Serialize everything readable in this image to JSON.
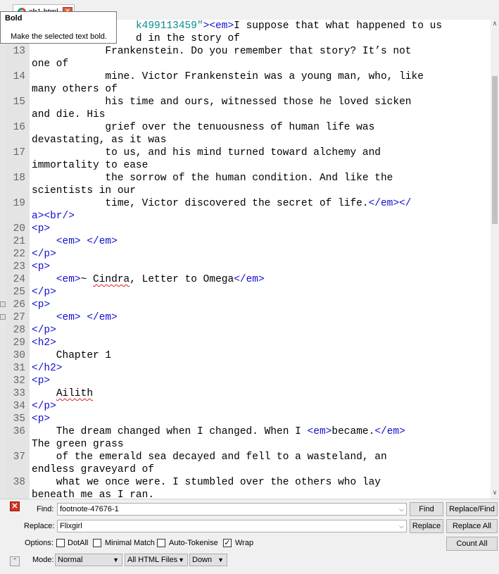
{
  "tab": {
    "label": "ch1.html",
    "close": "✕"
  },
  "tooltip": {
    "title": "Bold",
    "body": "Make the selected text bold."
  },
  "editor": {
    "lines": [
      {
        "n": "",
        "parts": [
          {
            "t": "                 "
          },
          {
            "t": "k499113459\"",
            "c": "str"
          },
          {
            "t": "><em>",
            "c": "tag"
          },
          {
            "t": "I suppose that what happened to us"
          }
        ]
      },
      {
        "n": "",
        "parts": [
          {
            "t": "                 d in the story of"
          }
        ]
      },
      {
        "n": "13",
        "parts": [
          {
            "t": "            Frankenstein. Do you remember that story? It’s not"
          }
        ]
      },
      {
        "n": "",
        "parts": [
          {
            "t": "one of"
          }
        ]
      },
      {
        "n": "14",
        "parts": [
          {
            "t": "            mine. Victor Frankenstein was a young man, who, like"
          }
        ]
      },
      {
        "n": "",
        "parts": [
          {
            "t": "many others of"
          }
        ]
      },
      {
        "n": "15",
        "parts": [
          {
            "t": "            his time and ours, witnessed those he loved sicken"
          }
        ]
      },
      {
        "n": "",
        "parts": [
          {
            "t": "and die. His"
          }
        ]
      },
      {
        "n": "16",
        "parts": [
          {
            "t": "            grief over the tenuousness of human life was"
          }
        ]
      },
      {
        "n": "",
        "parts": [
          {
            "t": "devastating, as it was"
          }
        ]
      },
      {
        "n": "17",
        "parts": [
          {
            "t": "            to us, and his mind turned toward alchemy and"
          }
        ]
      },
      {
        "n": "",
        "parts": [
          {
            "t": "immortality to ease"
          }
        ]
      },
      {
        "n": "18",
        "parts": [
          {
            "t": "            the sorrow of the human condition. And like the"
          }
        ]
      },
      {
        "n": "",
        "parts": [
          {
            "t": "scientists in our"
          }
        ]
      },
      {
        "n": "19",
        "parts": [
          {
            "t": "            time, Victor discovered the secret of life."
          },
          {
            "t": "</em></",
            "c": "tag"
          }
        ]
      },
      {
        "n": "",
        "parts": [
          {
            "t": "a><br/>",
            "c": "tag"
          }
        ]
      },
      {
        "n": "20",
        "parts": [
          {
            "t": "<p>",
            "c": "tag"
          }
        ]
      },
      {
        "n": "21",
        "parts": [
          {
            "t": "    "
          },
          {
            "t": "<em>",
            "c": "tag"
          },
          {
            "t": " "
          },
          {
            "t": "</em>",
            "c": "tag"
          }
        ]
      },
      {
        "n": "22",
        "parts": [
          {
            "t": "</p>",
            "c": "tag"
          }
        ]
      },
      {
        "n": "23",
        "parts": [
          {
            "t": "<p>",
            "c": "tag"
          }
        ]
      },
      {
        "n": "24",
        "parts": [
          {
            "t": "    "
          },
          {
            "t": "<em>",
            "c": "tag"
          },
          {
            "t": "~ "
          },
          {
            "t": "Cindra",
            "s": true
          },
          {
            "t": ", Letter to Omega"
          },
          {
            "t": "</em>",
            "c": "tag"
          }
        ]
      },
      {
        "n": "25",
        "parts": [
          {
            "t": "</p>",
            "c": "tag"
          }
        ]
      },
      {
        "n": "26",
        "parts": [
          {
            "t": "<p>",
            "c": "tag"
          }
        ]
      },
      {
        "n": "27",
        "parts": [
          {
            "t": "    "
          },
          {
            "t": "<em>",
            "c": "tag"
          },
          {
            "t": " "
          },
          {
            "t": "</em>",
            "c": "tag"
          }
        ]
      },
      {
        "n": "28",
        "parts": [
          {
            "t": "</p>",
            "c": "tag"
          }
        ]
      },
      {
        "n": "29",
        "parts": [
          {
            "t": "<h2>",
            "c": "tag"
          }
        ]
      },
      {
        "n": "30",
        "parts": [
          {
            "t": "    Chapter 1"
          }
        ]
      },
      {
        "n": "31",
        "parts": [
          {
            "t": "</h2>",
            "c": "tag"
          }
        ]
      },
      {
        "n": "32",
        "parts": [
          {
            "t": "<p>",
            "c": "tag"
          }
        ]
      },
      {
        "n": "33",
        "parts": [
          {
            "t": "    "
          },
          {
            "t": "Ailith",
            "s": true
          }
        ]
      },
      {
        "n": "34",
        "parts": [
          {
            "t": "</p>",
            "c": "tag"
          }
        ]
      },
      {
        "n": "35",
        "parts": [
          {
            "t": "<p>",
            "c": "tag"
          }
        ]
      },
      {
        "n": "36",
        "parts": [
          {
            "t": "    The dream changed when I changed. When I "
          },
          {
            "t": "<em>",
            "c": "tag"
          },
          {
            "t": "became."
          },
          {
            "t": "</em>",
            "c": "tag"
          }
        ]
      },
      {
        "n": "",
        "parts": [
          {
            "t": "The green grass"
          }
        ]
      },
      {
        "n": "37",
        "parts": [
          {
            "t": "    of the emerald sea decayed and fell to a wasteland, an"
          }
        ]
      },
      {
        "n": "",
        "parts": [
          {
            "t": "endless graveyard of"
          }
        ]
      },
      {
        "n": "38",
        "parts": [
          {
            "t": "    what we once were. I stumbled over the others who lay"
          }
        ]
      },
      {
        "n": "",
        "parts": [
          {
            "t": "beneath me as I ran."
          }
        ]
      }
    ]
  },
  "find": {
    "find_label": "Find:",
    "find_value": "footnote-47676-1",
    "replace_label": "Replace:",
    "replace_value": "Flixgirl",
    "options_label": "Options:",
    "dotall": "DotAll",
    "minimal": "Minimal Match",
    "autotokenise": "Auto-Tokenise",
    "wrap": "Wrap",
    "wrap_checked": true,
    "mode_label": "Mode:",
    "mode_value": "Normal",
    "scope_value": "All HTML Files",
    "direction_value": "Down",
    "btn_find": "Find",
    "btn_replace_find": "Replace/Find",
    "btn_replace": "Replace",
    "btn_replace_all": "Replace All",
    "btn_count_all": "Count All"
  },
  "colors": {
    "tag": "#1010d0",
    "string": "#0a8a8a",
    "gutter": "#e4e4e4"
  }
}
